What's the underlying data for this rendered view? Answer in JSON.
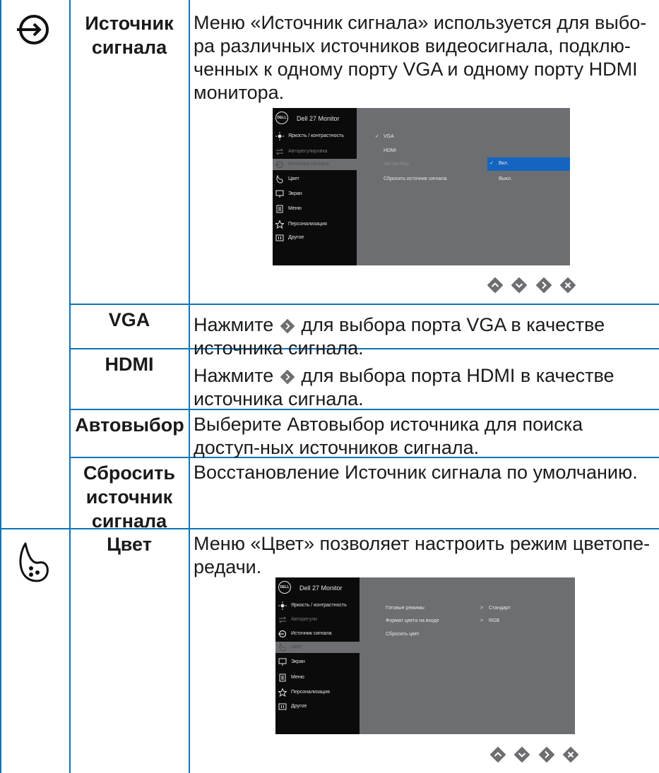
{
  "rows": {
    "input_source": {
      "name": "Источник сигнала",
      "desc": "Меню «Источник сигнала» используется для выбо-ра различных источников видеосигнала, подклю-ченных к одному порту VGA и одному порту HDMI монитора."
    },
    "vga": {
      "name": "VGA",
      "desc_before": "Нажмите",
      "desc_after": "для выбора порта VGA в качестве источника сигнала."
    },
    "hdmi": {
      "name": "HDMI",
      "desc_before": "Нажмите",
      "desc_after": "для выбора порта HDMI в качестве источника сигнала."
    },
    "auto": {
      "name": "Автовыбор",
      "desc": "Выберите Автовыбор источника для поиска доступ-ных источников сигнала."
    },
    "reset": {
      "name": "Сбросить источник сигнала",
      "desc": "Восстановление Источник сигнала по умолчанию."
    },
    "color": {
      "name": "Цвет",
      "desc": "Меню «Цвет» позволяет настроить режим цветопе-редачи."
    }
  },
  "osd1": {
    "logo": "DELL",
    "title": "Dell 27 Monitor",
    "menu": [
      "Яркость / контрастность",
      "Авторегулировка",
      "Источник сигнала",
      "Цвет",
      "Экран",
      "Меню",
      "Персонализация",
      "Другое"
    ],
    "options": [
      "VGA",
      "HDMI",
      "Автовыбор",
      "Сбросить источник сигнала"
    ],
    "check": "✓",
    "sub": [
      "Вкл.",
      "Выкл."
    ]
  },
  "osd2": {
    "logo": "DELL",
    "title": "Dell 27 Monitor",
    "menu": [
      "Яркость / контрастность",
      "Авторегули",
      "Источник сигнала",
      "Цвет",
      "Экран",
      "Меню",
      "Персонализация",
      "Другое"
    ],
    "options": [
      "Готовые режимы",
      "Формат цвета на входе",
      "Сбросить цвет"
    ],
    "values": [
      "Стандарт",
      "RGB"
    ],
    "arrow": ">"
  },
  "icons": [
    "input-source-icon",
    "color-palette-icon",
    "brightness-icon",
    "auto-adjust-icon",
    "monitor-icon",
    "menu-icon",
    "star-icon",
    "other-icon",
    "up-button-icon",
    "down-button-icon",
    "right-button-icon",
    "close-button-icon"
  ],
  "colors": {
    "rule": "#0b74b8",
    "osd_left": "#0b0b0b",
    "osd_right": "#6d6e71",
    "highlight": "#1565c0",
    "button": "#6d6e71"
  }
}
